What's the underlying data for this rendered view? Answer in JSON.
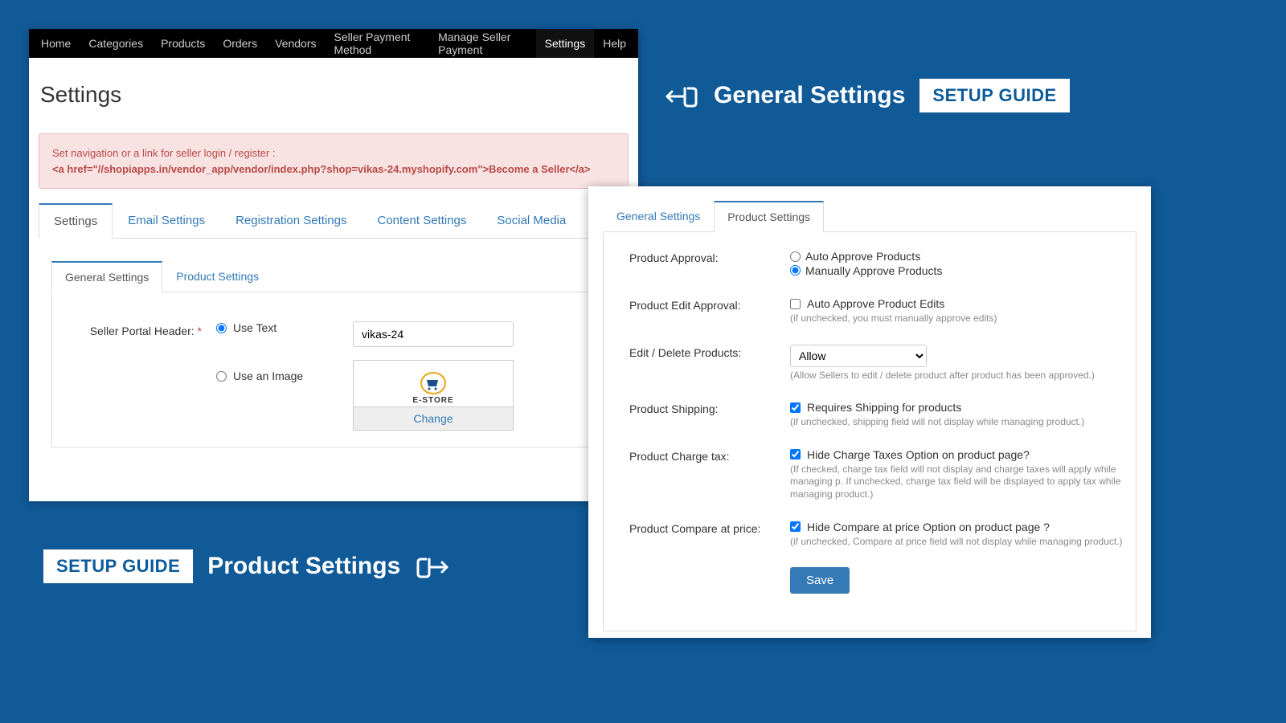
{
  "topnav": {
    "items": [
      "Home",
      "Categories",
      "Products",
      "Orders",
      "Vendors",
      "Seller Payment Method",
      "Manage Seller Payment",
      "Settings",
      "Help"
    ],
    "active": "Settings"
  },
  "page_title": "Settings",
  "alert": {
    "line1": "Set navigation or a link for seller login / register :",
    "line2": "<a href=\"//shopiapps.in/vendor_app/vendor/index.php?shop=vikas-24.myshopify.com\">Become a Seller</a>"
  },
  "tabs": {
    "items": [
      "Settings",
      "Email Settings",
      "Registration Settings",
      "Content Settings",
      "Social Media"
    ],
    "active": "Settings"
  },
  "inner_tabs_left": {
    "items": [
      "General Settings",
      "Product Settings"
    ],
    "active": "General Settings"
  },
  "left_form": {
    "seller_portal_header_label": "Seller Portal Header:",
    "use_text_label": "Use Text",
    "use_image_label": "Use an Image",
    "text_value": "vikas-24",
    "logo_text": "E-STORE",
    "change_label": "Change"
  },
  "callout_top": {
    "title": "General Settings",
    "badge": "SETUP GUIDE"
  },
  "callout_bottom": {
    "badge": "SETUP GUIDE",
    "title": "Product Settings"
  },
  "inner_tabs_right": {
    "items": [
      "General Settings",
      "Product Settings"
    ],
    "active": "Product Settings"
  },
  "right_form": {
    "product_approval": {
      "label": "Product Approval:",
      "opt_auto": "Auto Approve Products",
      "opt_manual": "Manually Approve Products"
    },
    "product_edit_approval": {
      "label": "Product Edit Approval:",
      "checkbox": "Auto Approve Product Edits",
      "helper": "(if unchecked, you must manually approve edits)"
    },
    "edit_delete": {
      "label": "Edit / Delete Products:",
      "select_value": "Allow",
      "helper": "(Allow Sellers to edit / delete product after product has been approved.)"
    },
    "shipping": {
      "label": "Product Shipping:",
      "checkbox": "Requires Shipping for products",
      "helper": "(if unchecked, shipping field will not display while managing product.)"
    },
    "charge_tax": {
      "label": "Product Charge tax:",
      "checkbox": "Hide Charge Taxes Option on product page?",
      "helper": "(If checked, charge tax field will not display and charge taxes will apply while managing p. If unchecked, charge tax field will be displayed to apply tax while managing product.)"
    },
    "compare_price": {
      "label": "Product Compare at price:",
      "checkbox": "Hide Compare at price Option on product page ?",
      "helper": "(if unchecked, Compare at price field will not display while managing product.)"
    },
    "save": "Save"
  }
}
